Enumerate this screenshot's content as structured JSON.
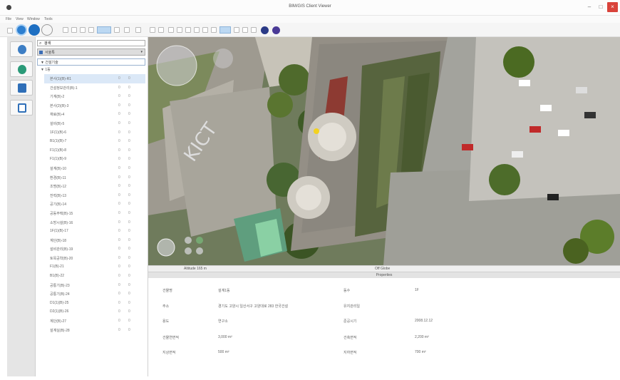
{
  "window": {
    "title": "BIM/GIS Client Viewer",
    "minimize": "–",
    "maximize": "□",
    "close": "×"
  },
  "menu": [
    "File",
    "View",
    "Window",
    "Tools"
  ],
  "search": {
    "value": "검색"
  },
  "layer": {
    "label": "서울특"
  },
  "tree": {
    "root": "▼ 건설기술",
    "sub": "▼ 1동",
    "items": [
      {
        "name": "본사(1)(B)-R1",
        "c1": "0",
        "c2": "0"
      },
      {
        "name": "건설정보관리(B)-1",
        "c1": "0",
        "c2": "0"
      },
      {
        "name": "기계(B)-2",
        "c1": "0",
        "c2": "0"
      },
      {
        "name": "본사(2)(B)-3",
        "c1": "0",
        "c2": "0"
      },
      {
        "name": "재료(B)-4",
        "c1": "0",
        "c2": "0"
      },
      {
        "name": "설비(B)-5",
        "c1": "0",
        "c2": "0"
      },
      {
        "name": "1F(1)(B)-6",
        "c1": "0",
        "c2": "0"
      },
      {
        "name": "B1(1)(B)-7",
        "c1": "0",
        "c2": "0"
      },
      {
        "name": "F1(1)(B)-8",
        "c1": "0",
        "c2": "0"
      },
      {
        "name": "F1(1)(B)-9",
        "c1": "0",
        "c2": "0"
      },
      {
        "name": "설계(B)-10",
        "c1": "0",
        "c2": "0"
      },
      {
        "name": "환경(B)-11",
        "c1": "0",
        "c2": "0"
      },
      {
        "name": "조명(B)-12",
        "c1": "0",
        "c2": "0"
      },
      {
        "name": "전력(B)-13",
        "c1": "0",
        "c2": "0"
      },
      {
        "name": "공기(B)-14",
        "c1": "0",
        "c2": "0"
      },
      {
        "name": "공동주택(B)-15",
        "c1": "0",
        "c2": "0"
      },
      {
        "name": "소방시설(B)-16",
        "c1": "0",
        "c2": "0"
      },
      {
        "name": "1F(1)(B)-17",
        "c1": "0",
        "c2": "0"
      },
      {
        "name": "계단(B)-18",
        "c1": "0",
        "c2": "0"
      },
      {
        "name": "설비관리(B)-19",
        "c1": "0",
        "c2": "0"
      },
      {
        "name": "토목공학(B)-20",
        "c1": "0",
        "c2": "0"
      },
      {
        "name": "F1(B)-21",
        "c1": "0",
        "c2": "0"
      },
      {
        "name": "B1(B)-22",
        "c1": "0",
        "c2": "0"
      },
      {
        "name": "공통기(B)-23",
        "c1": "0",
        "c2": "0"
      },
      {
        "name": "공통기(B)-24",
        "c1": "0",
        "c2": "0"
      },
      {
        "name": "D1(1)(B)-25",
        "c1": "0",
        "c2": "0"
      },
      {
        "name": "D2(1)(B)-26",
        "c1": "0",
        "c2": "0"
      },
      {
        "name": "계단(B)-27",
        "c1": "0",
        "c2": "0"
      },
      {
        "name": "설계실(B)-28",
        "c1": "0",
        "c2": "0"
      }
    ]
  },
  "status": {
    "altitude": "Altitude 165 m",
    "center": "Off Globe"
  },
  "properties": {
    "header": "Properties",
    "rows": [
      [
        "건물명",
        "설계1동",
        "동수",
        "1F"
      ],
      [
        "주소",
        "경기도 고양시 일산서구 고양대로 283 한국건설",
        "유지관리일",
        ""
      ],
      [
        "용도",
        "연구소",
        "준공시기",
        "2008.12.12"
      ],
      [
        "건물연면적",
        "3,000 m²",
        "건축면적",
        "2,200 m²"
      ],
      [
        "지상면적",
        "500 m²",
        "지하면적",
        "700 m²"
      ]
    ]
  },
  "colors": {
    "selection": "#dbe8f7",
    "accent": "#1e6fc2",
    "close": "#d9433b"
  }
}
